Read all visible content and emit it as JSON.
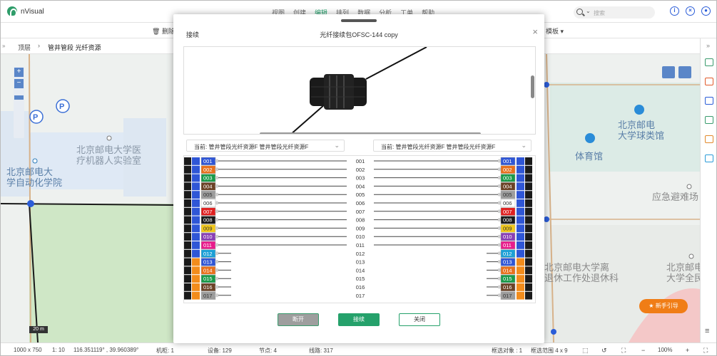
{
  "app": {
    "title": "nVisual"
  },
  "menu": [
    "视图",
    "创建",
    "编辑",
    "排列",
    "数据",
    "分析",
    "工单",
    "帮助"
  ],
  "menu_active": "编辑",
  "search": {
    "placeholder": "搜索"
  },
  "toolbar": {
    "delete_label": "删除",
    "template_label": "模板"
  },
  "breadcrumb": {
    "root": "顶层",
    "current": "管井管段 光纤资源"
  },
  "map_labels": {
    "lab": "北京邮电大学医\n疗机器人实验室",
    "auto": "北京邮电大\n学自动化学院",
    "ballhall": "北京邮电\n大学球类馆",
    "gym": "体育馆",
    "shelter": "应急避难场",
    "retire": "北京邮电大学离\n退休工作处退休科",
    "fit": "北京邮电\n大学全民健"
  },
  "guide_button": "新手引导",
  "scale_label": "20 m",
  "status": {
    "canvas_size": "1000 x 750",
    "ratio": "1: 10",
    "coords": "116.351119° , 39.960389°",
    "cabinet": "机柜: 1",
    "devices": "设备: 129",
    "nodes": "节点: 4",
    "lines": "线路: 317",
    "selected": "框选对象 : 1",
    "range": "框选范围 4 x 9",
    "zoom": "100%"
  },
  "modal": {
    "left_title": "接续",
    "title": "光纤接续包OFSC-144 copy",
    "left_select": "当前: 管井管段光纤资源F 管井管段光纤资源F",
    "right_select": "当前: 管井管段光纤资源F 管井管段光纤资源F",
    "buttons": {
      "disconnect": "断开",
      "connect": "接续",
      "close": "关闭"
    },
    "fibers": [
      "001",
      "002",
      "003",
      "004",
      "005",
      "006",
      "007",
      "008",
      "009",
      "010",
      "011",
      "012",
      "013",
      "014",
      "015",
      "016",
      "017"
    ],
    "fiber_colors": [
      "#2f56d6",
      "#e8701c",
      "#1a9a4a",
      "#6b4226",
      "#9c9c9c",
      "#ffffff",
      "#e02020",
      "#1a1a1a",
      "#f2c91c",
      "#8a3fb5",
      "#e81c8c",
      "#1b9fd6"
    ],
    "tube_colors": [
      "#2f56d6",
      "#f28c1c"
    ],
    "connected_count": 11
  }
}
